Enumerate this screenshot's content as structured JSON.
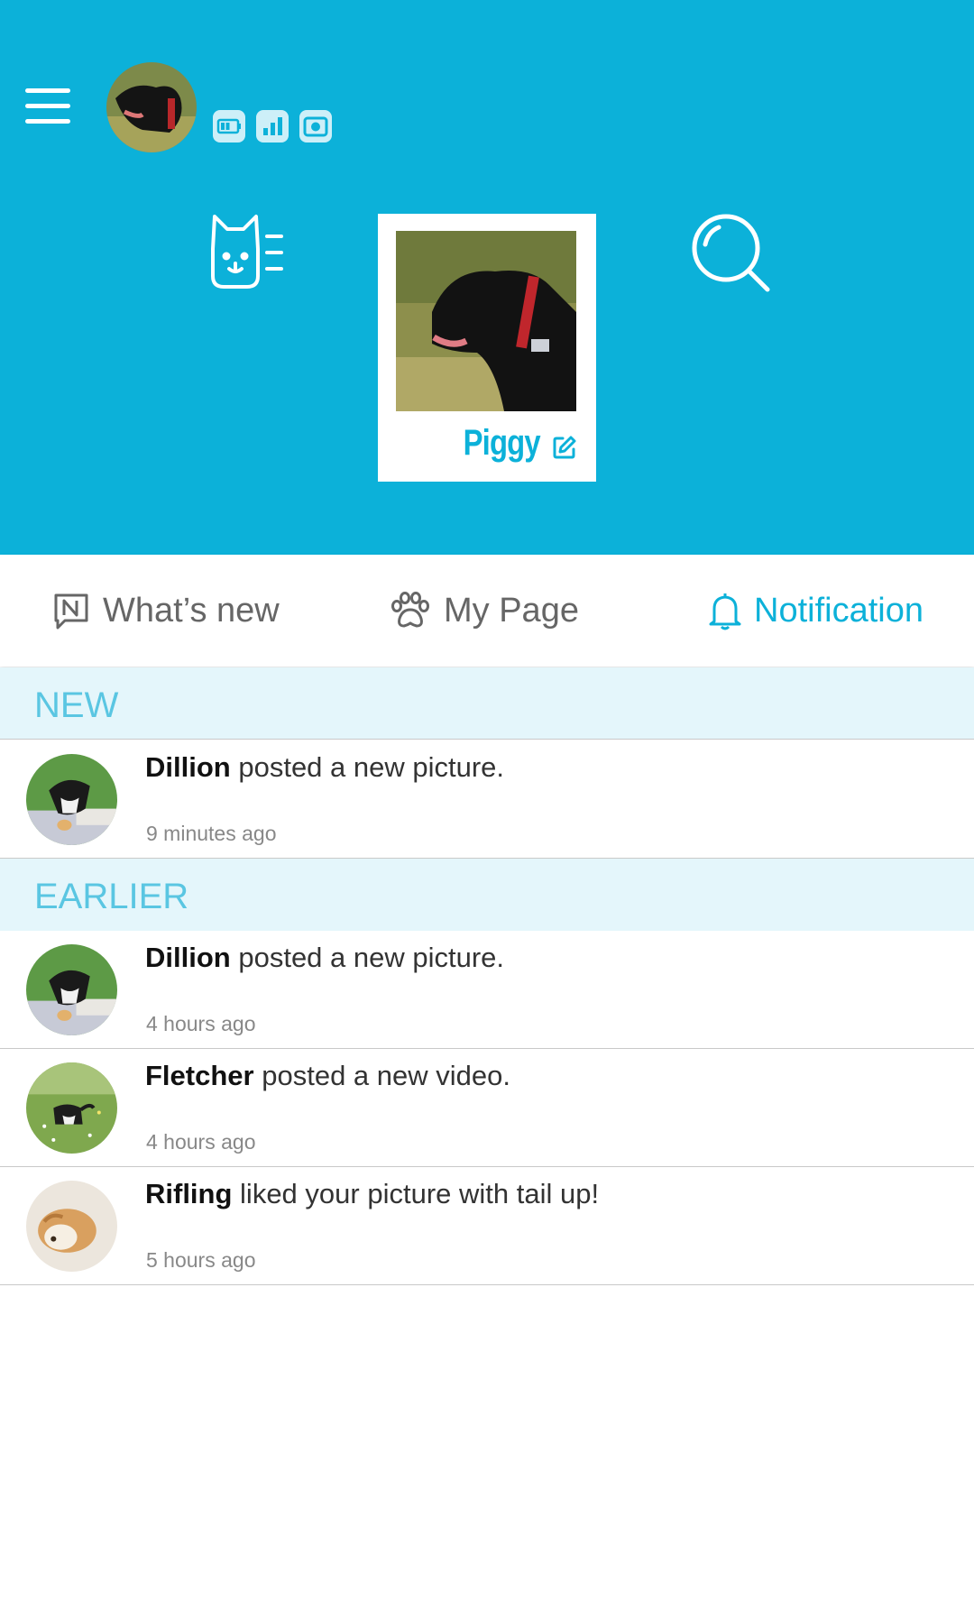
{
  "header": {
    "pet_name": "Piggy",
    "status_icons": [
      "battery-icon",
      "signal-bars-icon",
      "camera-icon"
    ]
  },
  "tabs": [
    {
      "label": "What’s new",
      "icon": "news-icon"
    },
    {
      "label": "My Page",
      "icon": "paw-icon"
    },
    {
      "label": "Notification",
      "icon": "bell-icon",
      "active": true
    }
  ],
  "sections": {
    "new": "NEW",
    "earlier": "EARLIER"
  },
  "notifications": [
    {
      "name": "Dillion",
      "text": "posted a new picture.",
      "time": "9 minutes ago"
    },
    {
      "name": "Dillion",
      "text": "posted a new picture.",
      "time": "4 hours ago"
    },
    {
      "name": "Fletcher",
      "text": "posted a new video.",
      "time": "4 hours ago"
    },
    {
      "name": "Rifling",
      "text": "liked your picture with tail up!",
      "time": "5 hours ago"
    }
  ],
  "colors": {
    "accent": "#0cb1d9",
    "section_bg": "#e4f6fb",
    "section_text": "#5ac6e2"
  }
}
